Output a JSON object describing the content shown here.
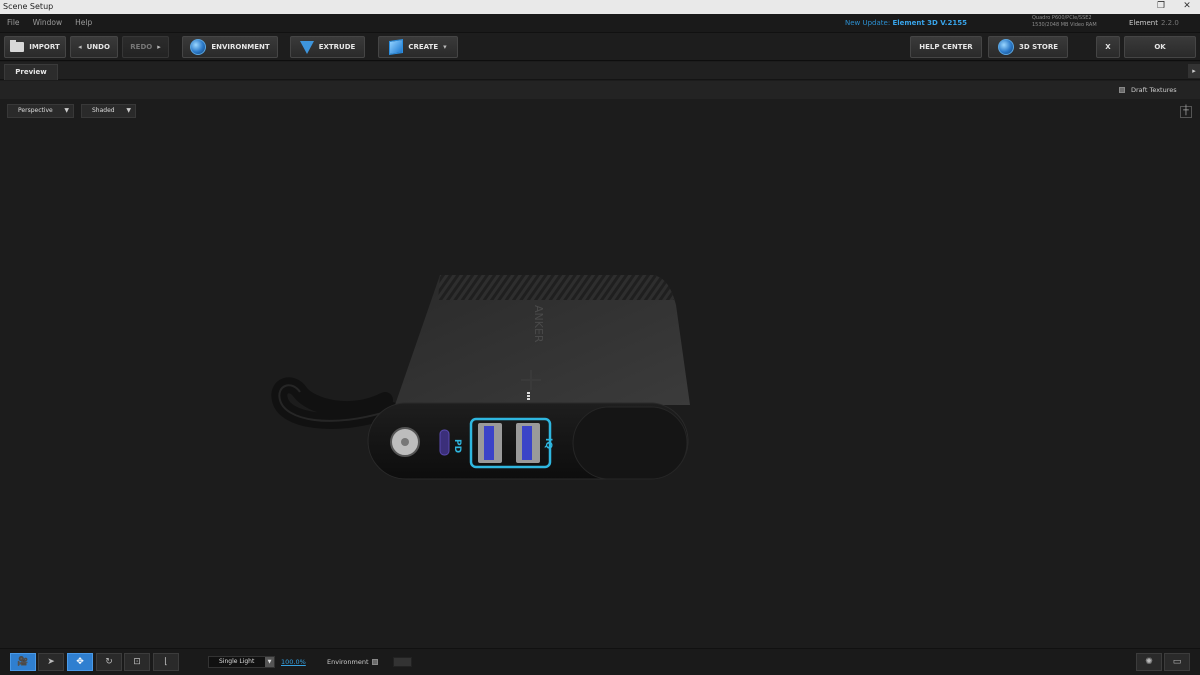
{
  "window": {
    "title": "Scene Setup",
    "restore_glyph": "❐",
    "close_glyph": "✕"
  },
  "menu": {
    "items": [
      "File",
      "Window",
      "Help"
    ]
  },
  "update": {
    "prefix": "New Update:",
    "product": "Element 3D V.2155"
  },
  "gpu": {
    "line1": "Quadro P600/PCIe/SSE2",
    "line2": "1530/2048 MB Video RAM"
  },
  "product": {
    "name": "Element",
    "version": "2.2.0"
  },
  "toolbar": {
    "import": "IMPORT",
    "undo": "UNDO",
    "redo": "REDO",
    "environment": "ENVIRONMENT",
    "extrude": "EXTRUDE",
    "create": "CREATE",
    "help_center": "HELP CENTER",
    "store": "3D STORE",
    "close": "X",
    "ok": "OK"
  },
  "tabs": {
    "preview": "Preview"
  },
  "options": {
    "draft_textures": "Draft Textures"
  },
  "viewport": {
    "camera": "Perspective",
    "shading": "Shaded",
    "model": {
      "brand": "ANKER",
      "pd": "PD",
      "iq": "IQ"
    }
  },
  "status": {
    "light_mode": "Single Light",
    "zoom": "100.0%",
    "environment_label": "Environment"
  },
  "colors": {
    "accent": "#2f7fd0",
    "update_link": "#38a4ea",
    "usb_outline": "#2fb7e0"
  }
}
